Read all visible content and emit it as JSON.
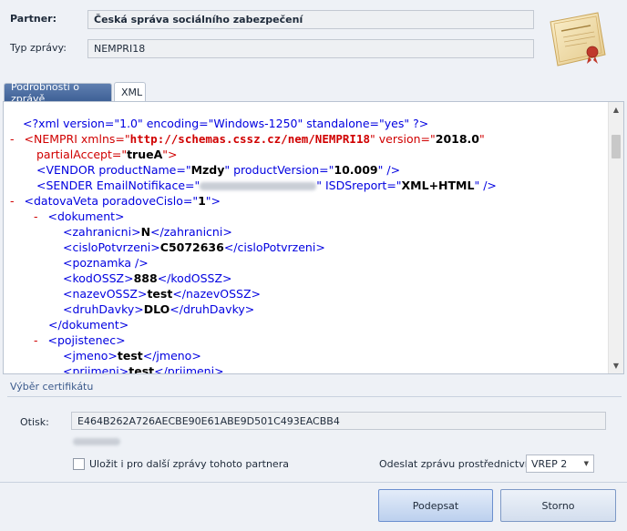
{
  "header": {
    "partner_label": "Partner:",
    "partner_value": "Česká správa sociálního zabezpečení",
    "type_label": "Typ zprávy:",
    "type_value": "NEMPRI18"
  },
  "tabs": [
    {
      "label": "Podrobnosti o zprávě",
      "active": false
    },
    {
      "label": "XML",
      "active": true
    }
  ],
  "xml": {
    "l1": "<?xml version=\"1.0\" encoding=\"Windows-1250\" standalone=\"yes\" ?>",
    "minus": "-",
    "nempri_open": "<NEMPRI",
    "xmlns_attr": " xmlns=\"",
    "xmlns_val": "http://schemas.cssz.cz/nem/NEMPRI18",
    "version_attr": "\" version=\"",
    "version_val": "2018.0",
    "quote": "\"",
    "partial_attr": "partialAccept=\"",
    "partial_val": "trueA",
    "partial_end": "\">",
    "vendor_open": "<VENDOR productName=\"",
    "vendor_name": "Mzdy",
    "vendor_mid": "\" productVersion=\"",
    "vendor_ver": "10.009",
    "vendor_end": "\" />",
    "sender_open": "<SENDER EmailNotifikace=\"",
    "sender_mid": "\" ISDSreport=\"",
    "sender_val": "XML+HTML",
    "sender_end": "\" />",
    "dv_open": "<datovaVeta poradoveCislo=\"",
    "dv_val": "1",
    "dv_end": "\">",
    "dok_open": "<dokument>",
    "zahr_o": "<zahranicni>",
    "zahr_v": "N",
    "zahr_c": "</zahranicni>",
    "cislo_o": "<cisloPotvrzeni>",
    "cislo_v": "C5072636",
    "cislo_c": "</cisloPotvrzeni>",
    "poz": "<poznamka />",
    "kod_o": "<kodOSSZ>",
    "kod_v": "888",
    "kod_c": "</kodOSSZ>",
    "naz_o": "<nazevOSSZ>",
    "naz_v": "test",
    "naz_c": "</nazevOSSZ>",
    "dd_o": "<druhDavky>",
    "dd_v": "DLO",
    "dd_c": "</druhDavky>",
    "dok_close": "</dokument>",
    "poj_open": "<pojistenec>",
    "jm_o": "<jmeno>",
    "jm_v": "test",
    "jm_c": "</jmeno>",
    "pr_o": "<prijmeni>",
    "pr_v": "test",
    "pr_c": "</prijmeni>"
  },
  "cert_section": {
    "title": "Výběr certifikátu",
    "otisk_label": "Otisk:",
    "otisk_value": "E464B262A726AECBE90E61ABE9D501C493EACBB4",
    "save_label": "Uložit i pro další zprávy tohoto partnera",
    "send_via_label": "Odeslat zprávu prostřednictvím",
    "send_via_value": "VREP 2"
  },
  "buttons": {
    "sign": "Podepsat",
    "cancel": "Storno"
  },
  "colors": {
    "tag_blue": "#0000e0",
    "minus_red": "#d00000",
    "tab_blue": "#3d5f95"
  }
}
